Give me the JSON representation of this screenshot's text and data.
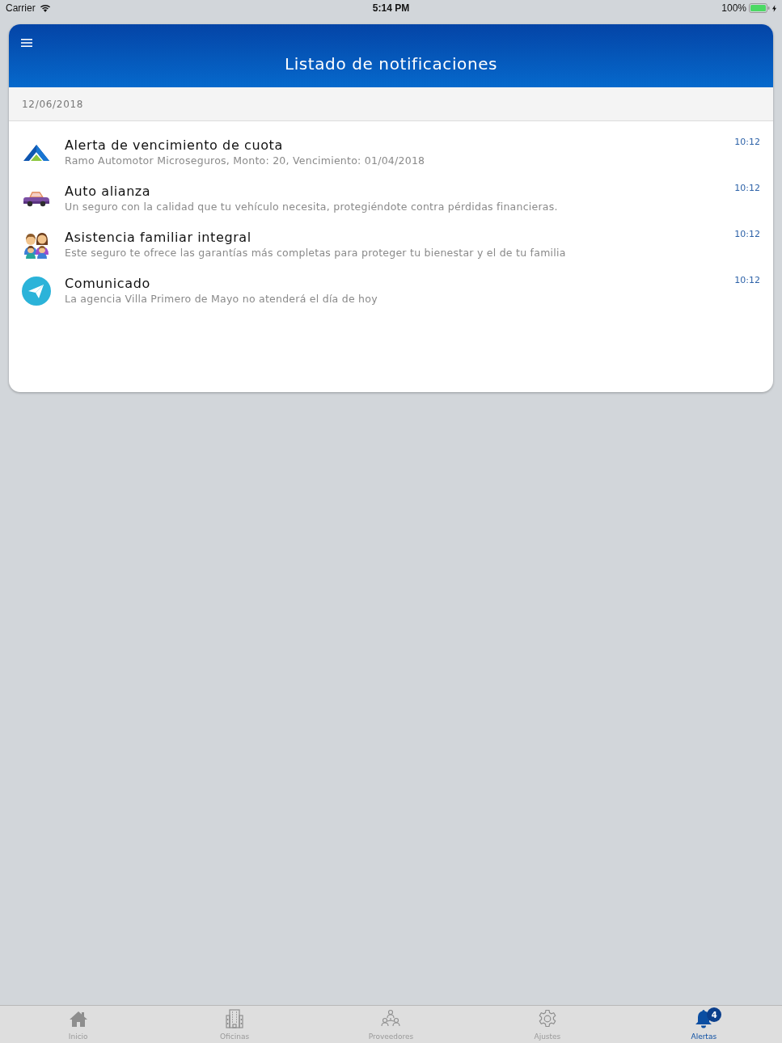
{
  "status_bar": {
    "carrier": "Carrier",
    "time": "5:14 PM",
    "battery": "100%"
  },
  "header": {
    "title": "Listado de notificaciones"
  },
  "date_header": "12/06/2018",
  "notifications": [
    {
      "kind": "logo",
      "title": "Alerta de vencimiento de cuota",
      "body": "Ramo Automotor Microseguros, Monto: 20, Vencimiento: 01/04/2018",
      "time": "10:12"
    },
    {
      "kind": "car",
      "title": "Auto alianza",
      "body": "Un seguro con la calidad que tu vehículo necesita, protegiéndote contra pérdidas financieras.",
      "time": "10:12"
    },
    {
      "kind": "family",
      "title": "Asistencia familiar integral",
      "body": "Este seguro te ofrece las garantías más completas para proteger tu bienestar y el de tu familia",
      "time": "10:12"
    },
    {
      "kind": "send",
      "title": "Comunicado",
      "body": "La agencia Villa Primero de Mayo no atenderá el día de hoy",
      "time": "10:12"
    }
  ],
  "tab_bar": {
    "tabs": [
      {
        "kind": "home",
        "label": "Inicio",
        "selected": false
      },
      {
        "kind": "building",
        "label": "Oficinas",
        "selected": false
      },
      {
        "kind": "people",
        "label": "Proveedores",
        "selected": false
      },
      {
        "kind": "gear",
        "label": "Ajustes",
        "selected": false
      },
      {
        "kind": "bell",
        "label": "Alertas",
        "selected": true,
        "badge": "4"
      }
    ]
  }
}
